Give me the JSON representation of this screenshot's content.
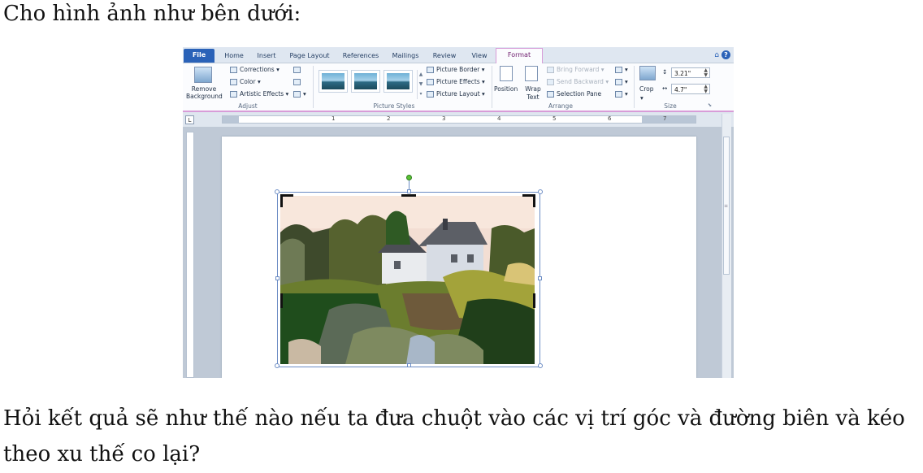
{
  "question": {
    "intro": "Cho hình ảnh như bên dưới:",
    "text": "Hỏi kết quả sẽ như thế nào nếu ta đưa chuột vào các vị trí góc và đường biên và kéo theo xu thế co lại?"
  },
  "ribbon": {
    "tabs": [
      {
        "label": "File"
      },
      {
        "label": "Home"
      },
      {
        "label": "Insert"
      },
      {
        "label": "Page Layout"
      },
      {
        "label": "References"
      },
      {
        "label": "Mailings"
      },
      {
        "label": "Review"
      },
      {
        "label": "View"
      },
      {
        "label": "Format"
      }
    ],
    "active_tab": "Format",
    "help_icon": "?",
    "adjust": {
      "remove_background": "Remove Background",
      "corrections": "Corrections",
      "color": "Color",
      "artistic_effects": "Artistic Effects",
      "label": "Adjust"
    },
    "picture_styles": {
      "picture_border": "Picture Border",
      "picture_effects": "Picture Effects",
      "picture_layout": "Picture Layout",
      "label": "Picture Styles"
    },
    "arrange": {
      "position": "Position",
      "wrap_text": "Wrap Text",
      "bring_forward": "Bring Forward",
      "send_backward": "Send Backward",
      "selection_pane": "Selection Pane",
      "label": "Arrange"
    },
    "size": {
      "crop": "Crop",
      "height": "3.21\"",
      "width": "4.7\"",
      "label": "Size"
    }
  },
  "ruler": {
    "corner": "L",
    "numbers": [
      "1",
      "2",
      "3",
      "4",
      "5",
      "6",
      "7"
    ]
  },
  "colors": {
    "file_tab": "#2a62b8",
    "format_tab_accent": "#d89cd8",
    "selection_border": "#6b8cc4",
    "rotation_handle": "#5bc236"
  }
}
